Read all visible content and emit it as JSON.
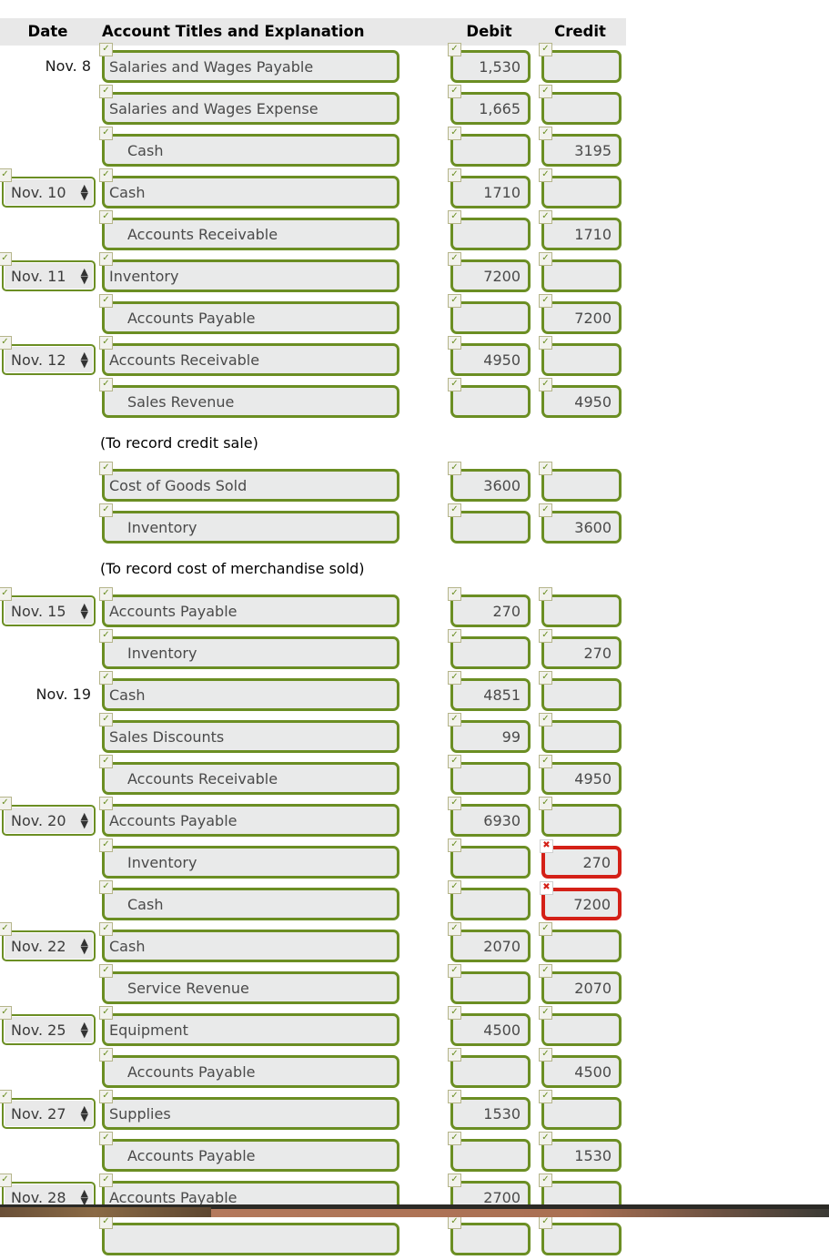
{
  "header": {
    "columns": [
      {
        "key": "date",
        "label": "Date"
      },
      {
        "key": "account",
        "label": "Account Titles and Explanation"
      },
      {
        "key": "debit",
        "label": "Debit"
      },
      {
        "key": "credit",
        "label": "Credit"
      }
    ]
  },
  "icons": {
    "valid_badge": "check-icon",
    "error_badge": "cross-icon",
    "select_arrows": "stepper-arrows-icon"
  },
  "colors": {
    "valid_border": "#6b8e23",
    "error_border": "#d42017",
    "field_fill": "#e9eaea",
    "header_band": "#e8e8e8",
    "page_background": "#ffffff",
    "field_text": "#4a4a4a",
    "explanation_text": "#000000"
  },
  "select_arrows_glyph": {
    "up": "▲",
    "down": "▼"
  },
  "rows": [
    {
      "type": "entry",
      "date": {
        "kind": "text",
        "value": "Nov. 8"
      },
      "account": {
        "value": "Salaries and Wages Payable",
        "indent": false,
        "status": "valid"
      },
      "debit": {
        "value": "1,530",
        "status": "valid"
      },
      "credit": {
        "value": "",
        "status": "valid"
      }
    },
    {
      "type": "entry",
      "date": {
        "kind": "none",
        "value": ""
      },
      "account": {
        "value": "Salaries and Wages Expense",
        "indent": false,
        "status": "valid"
      },
      "debit": {
        "value": "1,665",
        "status": "valid"
      },
      "credit": {
        "value": "",
        "status": "valid"
      }
    },
    {
      "type": "entry",
      "date": {
        "kind": "none",
        "value": ""
      },
      "account": {
        "value": "Cash",
        "indent": true,
        "status": "valid"
      },
      "debit": {
        "value": "",
        "status": "valid"
      },
      "credit": {
        "value": "3195",
        "status": "valid"
      }
    },
    {
      "type": "entry",
      "date": {
        "kind": "select",
        "value": "Nov. 10"
      },
      "account": {
        "value": "Cash",
        "indent": false,
        "status": "valid"
      },
      "debit": {
        "value": "1710",
        "status": "valid"
      },
      "credit": {
        "value": "",
        "status": "valid"
      }
    },
    {
      "type": "entry",
      "date": {
        "kind": "none",
        "value": ""
      },
      "account": {
        "value": "Accounts Receivable",
        "indent": true,
        "status": "valid"
      },
      "debit": {
        "value": "",
        "status": "valid"
      },
      "credit": {
        "value": "1710",
        "status": "valid"
      }
    },
    {
      "type": "entry",
      "date": {
        "kind": "select",
        "value": "Nov. 11"
      },
      "account": {
        "value": "Inventory",
        "indent": false,
        "status": "valid"
      },
      "debit": {
        "value": "7200",
        "status": "valid"
      },
      "credit": {
        "value": "",
        "status": "valid"
      }
    },
    {
      "type": "entry",
      "date": {
        "kind": "none",
        "value": ""
      },
      "account": {
        "value": "Accounts Payable",
        "indent": true,
        "status": "valid"
      },
      "debit": {
        "value": "",
        "status": "valid"
      },
      "credit": {
        "value": "7200",
        "status": "valid"
      }
    },
    {
      "type": "entry",
      "date": {
        "kind": "select",
        "value": "Nov. 12"
      },
      "account": {
        "value": "Accounts Receivable",
        "indent": false,
        "status": "valid"
      },
      "debit": {
        "value": "4950",
        "status": "valid"
      },
      "credit": {
        "value": "",
        "status": "valid"
      }
    },
    {
      "type": "entry",
      "date": {
        "kind": "none",
        "value": ""
      },
      "account": {
        "value": "Sales Revenue",
        "indent": true,
        "status": "valid"
      },
      "debit": {
        "value": "",
        "status": "valid"
      },
      "credit": {
        "value": "4950",
        "status": "valid"
      }
    },
    {
      "type": "explanation",
      "text": "(To record credit sale)"
    },
    {
      "type": "entry",
      "date": {
        "kind": "none",
        "value": ""
      },
      "account": {
        "value": "Cost of Goods Sold",
        "indent": false,
        "status": "valid"
      },
      "debit": {
        "value": "3600",
        "status": "valid"
      },
      "credit": {
        "value": "",
        "status": "valid"
      }
    },
    {
      "type": "entry",
      "date": {
        "kind": "none",
        "value": ""
      },
      "account": {
        "value": "Inventory",
        "indent": true,
        "status": "valid"
      },
      "debit": {
        "value": "",
        "status": "valid"
      },
      "credit": {
        "value": "3600",
        "status": "valid"
      }
    },
    {
      "type": "explanation",
      "text": "(To record cost of merchandise sold)"
    },
    {
      "type": "entry",
      "date": {
        "kind": "select",
        "value": "Nov. 15"
      },
      "account": {
        "value": "Accounts Payable",
        "indent": false,
        "status": "valid"
      },
      "debit": {
        "value": "270",
        "status": "valid"
      },
      "credit": {
        "value": "",
        "status": "valid"
      }
    },
    {
      "type": "entry",
      "date": {
        "kind": "none",
        "value": ""
      },
      "account": {
        "value": "Inventory",
        "indent": true,
        "status": "valid"
      },
      "debit": {
        "value": "",
        "status": "valid"
      },
      "credit": {
        "value": "270",
        "status": "valid"
      }
    },
    {
      "type": "entry",
      "date": {
        "kind": "text",
        "value": "Nov. 19"
      },
      "account": {
        "value": "Cash",
        "indent": false,
        "status": "valid"
      },
      "debit": {
        "value": "4851",
        "status": "valid"
      },
      "credit": {
        "value": "",
        "status": "valid"
      }
    },
    {
      "type": "entry",
      "date": {
        "kind": "none",
        "value": ""
      },
      "account": {
        "value": "Sales Discounts",
        "indent": false,
        "status": "valid"
      },
      "debit": {
        "value": "99",
        "status": "valid"
      },
      "credit": {
        "value": "",
        "status": "valid"
      }
    },
    {
      "type": "entry",
      "date": {
        "kind": "none",
        "value": ""
      },
      "account": {
        "value": "Accounts Receivable",
        "indent": true,
        "status": "valid"
      },
      "debit": {
        "value": "",
        "status": "valid"
      },
      "credit": {
        "value": "4950",
        "status": "valid"
      }
    },
    {
      "type": "entry",
      "date": {
        "kind": "select",
        "value": "Nov. 20"
      },
      "account": {
        "value": "Accounts Payable",
        "indent": false,
        "status": "valid"
      },
      "debit": {
        "value": "6930",
        "status": "valid"
      },
      "credit": {
        "value": "",
        "status": "valid"
      }
    },
    {
      "type": "entry",
      "date": {
        "kind": "none",
        "value": ""
      },
      "account": {
        "value": "Inventory",
        "indent": true,
        "status": "valid"
      },
      "debit": {
        "value": "",
        "status": "valid"
      },
      "credit": {
        "value": "270",
        "status": "error"
      }
    },
    {
      "type": "entry",
      "date": {
        "kind": "none",
        "value": ""
      },
      "account": {
        "value": "Cash",
        "indent": true,
        "status": "valid"
      },
      "debit": {
        "value": "",
        "status": "valid"
      },
      "credit": {
        "value": "7200",
        "status": "error"
      }
    },
    {
      "type": "entry",
      "date": {
        "kind": "select",
        "value": "Nov. 22"
      },
      "account": {
        "value": "Cash",
        "indent": false,
        "status": "valid"
      },
      "debit": {
        "value": "2070",
        "status": "valid"
      },
      "credit": {
        "value": "",
        "status": "valid"
      }
    },
    {
      "type": "entry",
      "date": {
        "kind": "none",
        "value": ""
      },
      "account": {
        "value": "Service Revenue",
        "indent": true,
        "status": "valid"
      },
      "debit": {
        "value": "",
        "status": "valid"
      },
      "credit": {
        "value": "2070",
        "status": "valid"
      }
    },
    {
      "type": "entry",
      "date": {
        "kind": "select",
        "value": "Nov. 25"
      },
      "account": {
        "value": "Equipment",
        "indent": false,
        "status": "valid"
      },
      "debit": {
        "value": "4500",
        "status": "valid"
      },
      "credit": {
        "value": "",
        "status": "valid"
      }
    },
    {
      "type": "entry",
      "date": {
        "kind": "none",
        "value": ""
      },
      "account": {
        "value": "Accounts Payable",
        "indent": true,
        "status": "valid"
      },
      "debit": {
        "value": "",
        "status": "valid"
      },
      "credit": {
        "value": "4500",
        "status": "valid"
      }
    },
    {
      "type": "entry",
      "date": {
        "kind": "select",
        "value": "Nov. 27"
      },
      "account": {
        "value": "Supplies",
        "indent": false,
        "status": "valid"
      },
      "debit": {
        "value": "1530",
        "status": "valid"
      },
      "credit": {
        "value": "",
        "status": "valid"
      }
    },
    {
      "type": "entry",
      "date": {
        "kind": "none",
        "value": ""
      },
      "account": {
        "value": "Accounts Payable",
        "indent": true,
        "status": "valid"
      },
      "debit": {
        "value": "",
        "status": "valid"
      },
      "credit": {
        "value": "1530",
        "status": "valid"
      }
    },
    {
      "type": "entry",
      "date": {
        "kind": "select",
        "value": "Nov. 28"
      },
      "account": {
        "value": "Accounts Payable",
        "indent": false,
        "status": "valid"
      },
      "debit": {
        "value": "2700",
        "status": "valid"
      },
      "credit": {
        "value": "",
        "status": "valid"
      }
    },
    {
      "type": "entry",
      "date": {
        "kind": "none",
        "value": ""
      },
      "account": {
        "value": "",
        "indent": false,
        "status": "valid"
      },
      "debit": {
        "value": "",
        "status": "valid"
      },
      "credit": {
        "value": "",
        "status": "valid"
      }
    }
  ]
}
